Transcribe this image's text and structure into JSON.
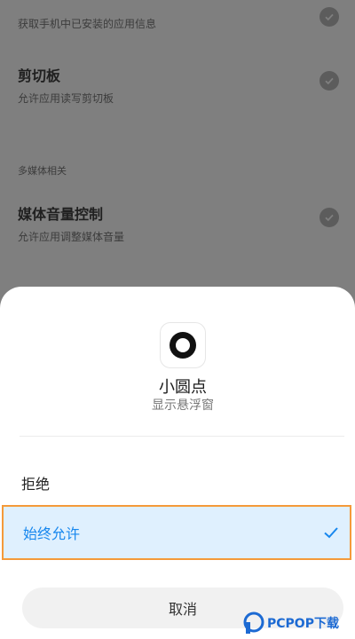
{
  "background": {
    "top_permission_desc": "获取手机中已安装的应用信息",
    "permissions": [
      {
        "title": "剪切板",
        "desc": "允许应用读写剪切板"
      },
      {
        "title": "媒体音量控制",
        "desc": "允许应用调整媒体音量"
      }
    ],
    "section_label": "多媒体相关"
  },
  "sheet": {
    "app_name": "小圆点",
    "app_subtitle": "显示悬浮窗",
    "options": [
      "拒绝",
      "始终允许"
    ],
    "cancel_label": "取消",
    "selected": "始终允许",
    "accent_color": "#1787ee",
    "highlight_border": "#f49a3a"
  },
  "watermark": {
    "text": "PCPOP下载"
  }
}
